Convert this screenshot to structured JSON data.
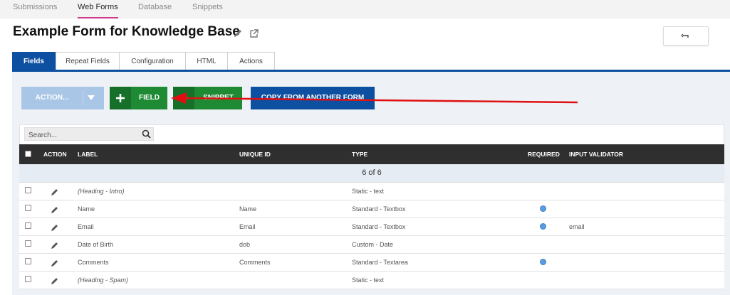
{
  "nav": {
    "items": [
      {
        "label": "Submissions"
      },
      {
        "label": "Web Forms"
      },
      {
        "label": "Database"
      },
      {
        "label": "Snippets"
      }
    ],
    "active": "Web Forms"
  },
  "form": {
    "title": "Example Form for Knowledge Base"
  },
  "tabs": [
    {
      "label": "Fields"
    },
    {
      "label": "Repeat Fields"
    },
    {
      "label": "Configuration"
    },
    {
      "label": "HTML"
    },
    {
      "label": "Actions"
    }
  ],
  "toolbar": {
    "action_label": "ACTION...",
    "field_label": "FIELD",
    "snippet_label": "SNIPPET",
    "copy_label": "COPY FROM ANOTHER FORM"
  },
  "search": {
    "placeholder": "Search..."
  },
  "table": {
    "headers": {
      "action": "ACTION",
      "label": "LABEL",
      "unique_id": "UNIQUE ID",
      "type": "TYPE",
      "required": "REQUIRED",
      "input_validator": "INPUT VALIDATOR"
    },
    "count": "6 of 6",
    "rows": [
      {
        "label": "(Heading - Intro)",
        "unique_id": "",
        "type": "Static - text",
        "required": false,
        "validator": ""
      },
      {
        "label": "Name",
        "unique_id": "Name",
        "type": "Standard - Textbox",
        "required": true,
        "validator": ""
      },
      {
        "label": "Email",
        "unique_id": "Email",
        "type": "Standard - Textbox",
        "required": true,
        "validator": "email"
      },
      {
        "label": "Date of Birth",
        "unique_id": "dob",
        "type": "Custom - Date",
        "required": false,
        "validator": ""
      },
      {
        "label": "Comments",
        "unique_id": "Comments",
        "type": "Standard - Textarea",
        "required": true,
        "validator": ""
      },
      {
        "label": "(Heading - Spam)",
        "unique_id": "",
        "type": "Static - text",
        "required": false,
        "validator": ""
      }
    ]
  },
  "colors": {
    "accent": "#0d4fa0",
    "nav_active_underline": "#d03a8c",
    "green_button": "#1e8a34",
    "action_button": "#a9c6e6",
    "required_dot": "#5b9be0",
    "annotation_arrow": "#e01010"
  }
}
